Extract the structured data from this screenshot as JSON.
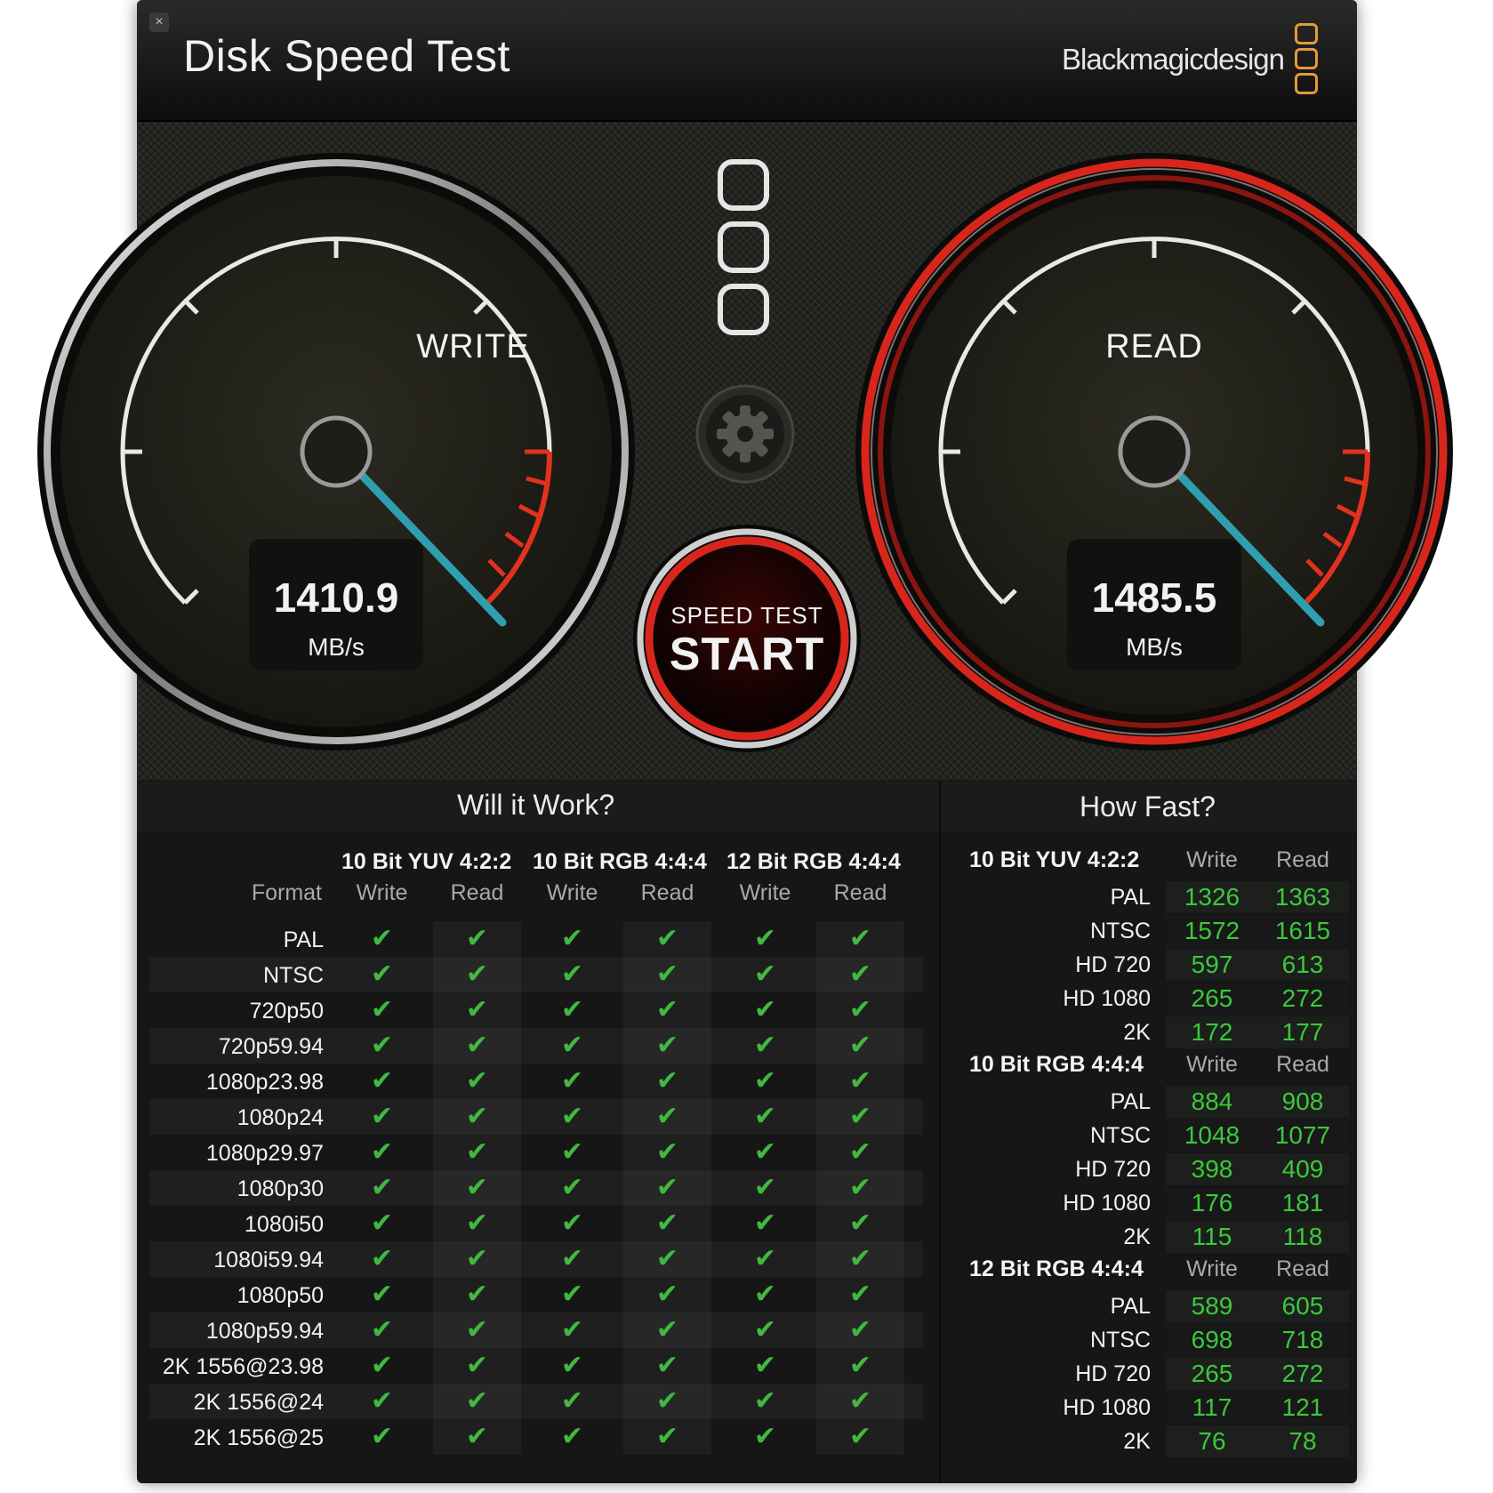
{
  "app": {
    "title": "Disk Speed Test",
    "brand": "Blackmagicdesign",
    "close_glyph": "×",
    "close_icon": "close-icon",
    "settings_icon": "gear-icon",
    "brand_logo_icon": "blackmagic-logo-icon"
  },
  "write_gauge": {
    "label": "WRITE",
    "value": "1410.9",
    "unit": "MB/s"
  },
  "read_gauge": {
    "label": "READ",
    "value": "1485.5",
    "unit": "MB/s"
  },
  "start_button": {
    "top_label": "SPEED TEST",
    "main_label": "START"
  },
  "will_it_work": {
    "title": "Will it Work?",
    "format_header": "Format",
    "groups": [
      "10 Bit YUV 4:2:2",
      "10 Bit RGB 4:4:4",
      "12 Bit RGB 4:4:4"
    ],
    "columns": [
      "Write",
      "Read",
      "Write",
      "Read",
      "Write",
      "Read"
    ],
    "formats": [
      "PAL",
      "NTSC",
      "720p50",
      "720p59.94",
      "1080p23.98",
      "1080p24",
      "1080p29.97",
      "1080p30",
      "1080i50",
      "1080i59.94",
      "1080p50",
      "1080p59.94",
      "2K 1556@23.98",
      "2K 1556@24",
      "2K 1556@25"
    ],
    "check_glyph": "✔",
    "check_icon": "checkmark-icon"
  },
  "how_fast": {
    "title": "How Fast?",
    "sections": [
      {
        "name": "10 Bit YUV 4:2:2",
        "write_header": "Write",
        "read_header": "Read",
        "rows": [
          [
            "PAL",
            "1326",
            "1363"
          ],
          [
            "NTSC",
            "1572",
            "1615"
          ],
          [
            "HD 720",
            "597",
            "613"
          ],
          [
            "HD 1080",
            "265",
            "272"
          ],
          [
            "2K",
            "172",
            "177"
          ]
        ]
      },
      {
        "name": "10 Bit RGB 4:4:4",
        "write_header": "Write",
        "read_header": "Read",
        "rows": [
          [
            "PAL",
            "884",
            "908"
          ],
          [
            "NTSC",
            "1048",
            "1077"
          ],
          [
            "HD 720",
            "398",
            "409"
          ],
          [
            "HD 1080",
            "176",
            "181"
          ],
          [
            "2K",
            "115",
            "118"
          ]
        ]
      },
      {
        "name": "12 Bit RGB 4:4:4",
        "write_header": "Write",
        "read_header": "Read",
        "rows": [
          [
            "PAL",
            "589",
            "605"
          ],
          [
            "NTSC",
            "698",
            "718"
          ],
          [
            "HD 720",
            "265",
            "272"
          ],
          [
            "HD 1080",
            "117",
            "121"
          ],
          [
            "2K",
            "76",
            "78"
          ]
        ]
      }
    ]
  },
  "colors": {
    "accent_red": "#d8261c",
    "needle": "#2f9fb0",
    "check_green": "#41b841",
    "number_green": "#3cc83c",
    "brand_orange": "#e39a3a"
  }
}
